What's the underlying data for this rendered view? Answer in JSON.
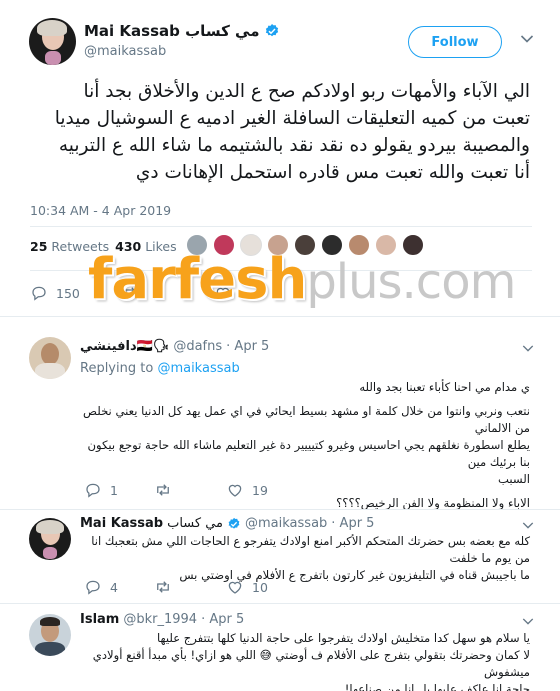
{
  "tweet": {
    "author_name": "Mai Kassab مي كساب",
    "handle": "@maikassab",
    "follow_label": "Follow",
    "text_lines": [
      "الي الآباء والأمهات ربو اولادكم صح ع الدين والأخلاق بجد أنا",
      "تعبت من كميه التعليقات السافلة الغير ادميه ع السوشيال ميديا",
      "والمصيبة بيردو يقولو ده نقد نقد بالشتيمه ما شاء الله ع التربيه",
      "أنا تعبت والله تعبت مس قادره استحمل الإهانات دي"
    ],
    "timestamp": "10:34 AM - 4 Apr 2019",
    "retweets_count": "25",
    "retweets_label": "Retweets",
    "likes_count": "430",
    "likes_label": "Likes",
    "reply_count": "150",
    "retweet_action_count": "",
    "like_action_count": ""
  },
  "watermark": {
    "part1": "farfesh",
    "part2": "plus.com"
  },
  "replies": [
    {
      "name": "دافينشي🇪🇬🗣",
      "handle": "@dafns",
      "date": "· Apr 5",
      "replying_prefix": "Replying to",
      "replying_to": "@maikassab",
      "lines": [
        "ي مدام مي احنا كأباء تعبنا بجد والله",
        "نتعب ونربي وانتوا من خلال كلمة او مشهد بسيط ايحائي في اي عمل يهد كل الدنيا يعني نخلص من الالماني",
        "يطلع اسطورة نغلقهم يجي احاسيس وغيرو كتيييير دة غير التعليم ماشاء الله حاجة توجع بيكون بنا برئيك مين",
        "السبب",
        "الاباء ولا المنظومة ولا الفن الرخيص؟؟؟؟"
      ],
      "reply_count": "1",
      "retweet_count": "",
      "like_count": "19"
    },
    {
      "name": "Mai Kassab",
      "name2": "مي كساب",
      "handle": "@maikassab",
      "date": "· Apr 5",
      "lines": [
        "كله مع بعضه بس حضرتك المتحكم الأكبر امنع اولادك يتفرجو ع الحاجات اللي مش بتعجبك انا من يوم ما خلفت",
        "ما باجيبش قناه في التليفزيون غير كارتون باتفرج ع الأفلام في اوضتي بس"
      ],
      "reply_count": "4",
      "retweet_count": "",
      "like_count": "10"
    },
    {
      "name": "Islam",
      "handle": "@bkr_1994",
      "date": "· Apr 5",
      "lines": [
        "يا سلام هو سهل كدا متخليش اولادك يتفرجوا على حاجة الدنيا كلها بتتفرج عليها",
        "لا كمان وحضرتك بتقولي بتفرج على الأفلام ف أوضتي 😅 اللي هو ازاي! بأي مبدأ أقنع أولادي ميشفوش",
        "حاجة انا عاكف عليها بل انا من صناعها!"
      ]
    }
  ],
  "colors": {
    "accent": "#1da1f2",
    "secondary_text": "#657786",
    "divider": "#e6ecf0",
    "like_heart": "#e0245e",
    "watermark_orange": "#f7a21b"
  },
  "icons": [
    "verified-badge-icon",
    "chevron-down-icon",
    "reply-icon",
    "retweet-icon",
    "like-icon"
  ]
}
